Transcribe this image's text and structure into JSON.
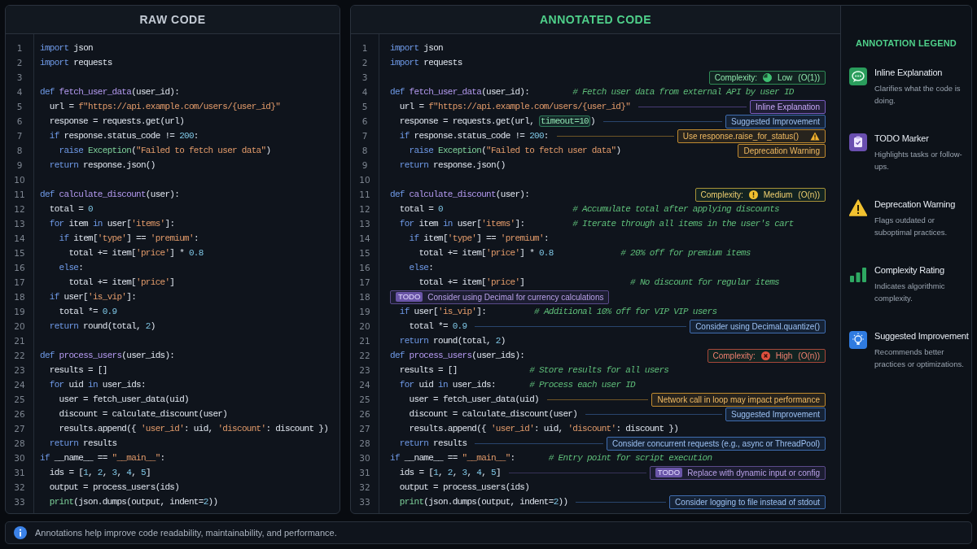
{
  "raw_panel": {
    "title": "RAW CODE",
    "lines": [
      {
        "number": "1",
        "tokens": [
          {
            "kind": "keyword",
            "text": "import"
          },
          {
            "kind": "plain",
            "text": " json"
          }
        ]
      },
      {
        "number": "2",
        "tokens": [
          {
            "kind": "keyword",
            "text": "import"
          },
          {
            "kind": "plain",
            "text": " requests"
          }
        ]
      },
      {
        "number": "3"
      },
      {
        "number": "4",
        "tokens": [
          {
            "kind": "keyword",
            "text": "def"
          },
          {
            "kind": "function",
            "text": " fetch_user_data"
          },
          {
            "kind": "plain",
            "text": "(user_id):"
          }
        ]
      },
      {
        "number": "5",
        "tokens": [
          {
            "kind": "plain",
            "text": "  url = "
          },
          {
            "kind": "string",
            "text": "f\"https://api.example.com/users/{user_id}\""
          }
        ]
      },
      {
        "number": "6",
        "tokens": [
          {
            "kind": "plain",
            "text": "  response = requests.get(url)"
          }
        ]
      },
      {
        "number": "7",
        "tokens": [
          {
            "kind": "keyword",
            "text": "  if"
          },
          {
            "kind": "plain",
            "text": " response.status_code != "
          },
          {
            "kind": "number",
            "text": "200"
          },
          {
            "kind": "plain",
            "text": ":"
          }
        ]
      },
      {
        "number": "8",
        "tokens": [
          {
            "kind": "keyword",
            "text": "    raise"
          },
          {
            "kind": "class",
            "text": " Exception"
          },
          {
            "kind": "plain",
            "text": "("
          },
          {
            "kind": "string",
            "text": "\"Failed to fetch user data\""
          },
          {
            "kind": "plain",
            "text": ")"
          }
        ]
      },
      {
        "number": "9",
        "tokens": [
          {
            "kind": "keyword",
            "text": "  return"
          },
          {
            "kind": "plain",
            "text": " response.json()"
          }
        ]
      },
      {
        "number": "10"
      },
      {
        "number": "11",
        "tokens": [
          {
            "kind": "keyword",
            "text": "def"
          },
          {
            "kind": "function",
            "text": " calculate_discount"
          },
          {
            "kind": "plain",
            "text": "(user):"
          }
        ]
      },
      {
        "number": "12",
        "tokens": [
          {
            "kind": "plain",
            "text": "  total = "
          },
          {
            "kind": "number",
            "text": "0"
          }
        ]
      },
      {
        "number": "13",
        "tokens": [
          {
            "kind": "keyword",
            "text": "  for"
          },
          {
            "kind": "plain",
            "text": " item "
          },
          {
            "kind": "keyword",
            "text": "in"
          },
          {
            "kind": "plain",
            "text": " user["
          },
          {
            "kind": "string",
            "text": "'items'"
          },
          {
            "kind": "plain",
            "text": "]:"
          }
        ]
      },
      {
        "number": "14",
        "tokens": [
          {
            "kind": "keyword",
            "text": "    if"
          },
          {
            "kind": "plain",
            "text": " item["
          },
          {
            "kind": "string",
            "text": "'type'"
          },
          {
            "kind": "plain",
            "text": "] == "
          },
          {
            "kind": "string",
            "text": "'premium'"
          },
          {
            "kind": "plain",
            "text": ":"
          }
        ]
      },
      {
        "number": "15",
        "tokens": [
          {
            "kind": "plain",
            "text": "      total += item["
          },
          {
            "kind": "string",
            "text": "'price'"
          },
          {
            "kind": "plain",
            "text": "] * "
          },
          {
            "kind": "number",
            "text": "0.8"
          }
        ]
      },
      {
        "number": "16",
        "tokens": [
          {
            "kind": "keyword",
            "text": "    else"
          },
          {
            "kind": "plain",
            "text": ":"
          }
        ]
      },
      {
        "number": "17",
        "tokens": [
          {
            "kind": "plain",
            "text": "      total += item["
          },
          {
            "kind": "string",
            "text": "'price'"
          },
          {
            "kind": "plain",
            "text": "]"
          }
        ]
      },
      {
        "number": "18",
        "tokens": [
          {
            "kind": "keyword",
            "text": "  if"
          },
          {
            "kind": "plain",
            "text": " user["
          },
          {
            "kind": "string",
            "text": "'is_vip'"
          },
          {
            "kind": "plain",
            "text": "]:"
          }
        ]
      },
      {
        "number": "19",
        "tokens": [
          {
            "kind": "plain",
            "text": "    total *= "
          },
          {
            "kind": "number",
            "text": "0.9"
          }
        ]
      },
      {
        "number": "20",
        "tokens": [
          {
            "kind": "keyword",
            "text": "  return"
          },
          {
            "kind": "plain",
            "text": " round(total, "
          },
          {
            "kind": "number",
            "text": "2"
          },
          {
            "kind": "plain",
            "text": ")"
          }
        ]
      },
      {
        "number": "21"
      },
      {
        "number": "22",
        "tokens": [
          {
            "kind": "keyword",
            "text": "def"
          },
          {
            "kind": "function",
            "text": " process_users"
          },
          {
            "kind": "plain",
            "text": "(user_ids):"
          }
        ]
      },
      {
        "number": "23",
        "tokens": [
          {
            "kind": "plain",
            "text": "  results = []"
          }
        ]
      },
      {
        "number": "24",
        "tokens": [
          {
            "kind": "keyword",
            "text": "  for"
          },
          {
            "kind": "plain",
            "text": " uid "
          },
          {
            "kind": "keyword",
            "text": "in"
          },
          {
            "kind": "plain",
            "text": " user_ids:"
          }
        ]
      },
      {
        "number": "25",
        "tokens": [
          {
            "kind": "plain",
            "text": "    user = fetch_user_data(uid)"
          }
        ]
      },
      {
        "number": "26",
        "tokens": [
          {
            "kind": "plain",
            "text": "    discount = calculate_discount(user)"
          }
        ]
      },
      {
        "number": "27",
        "tokens": [
          {
            "kind": "plain",
            "text": "    results.append({ "
          },
          {
            "kind": "string",
            "text": "'user_id'"
          },
          {
            "kind": "plain",
            "text": ": uid, "
          },
          {
            "kind": "string",
            "text": "'discount'"
          },
          {
            "kind": "plain",
            "text": ": discount })"
          }
        ]
      },
      {
        "number": "28",
        "tokens": [
          {
            "kind": "keyword",
            "text": "  return"
          },
          {
            "kind": "plain",
            "text": " results"
          }
        ]
      },
      {
        "number": "30",
        "tokens": [
          {
            "kind": "keyword",
            "text": "if"
          },
          {
            "kind": "plain",
            "text": " __name__ == "
          },
          {
            "kind": "string",
            "text": "\"__main__\""
          },
          {
            "kind": "plain",
            "text": ":"
          }
        ]
      },
      {
        "number": "31",
        "tokens": [
          {
            "kind": "plain",
            "text": "  ids = ["
          },
          {
            "kind": "number",
            "text": "1"
          },
          {
            "kind": "plain",
            "text": ", "
          },
          {
            "kind": "number",
            "text": "2"
          },
          {
            "kind": "plain",
            "text": ", "
          },
          {
            "kind": "number",
            "text": "3"
          },
          {
            "kind": "plain",
            "text": ", "
          },
          {
            "kind": "number",
            "text": "4"
          },
          {
            "kind": "plain",
            "text": ", "
          },
          {
            "kind": "number",
            "text": "5"
          },
          {
            "kind": "plain",
            "text": "]"
          }
        ]
      },
      {
        "number": "32",
        "tokens": [
          {
            "kind": "plain",
            "text": "  output = process_users(ids)"
          }
        ]
      },
      {
        "number": "33",
        "tokens": [
          {
            "kind": "class",
            "text": "  print"
          },
          {
            "kind": "plain",
            "text": "(json.dumps(output, indent="
          },
          {
            "kind": "number",
            "text": "2"
          },
          {
            "kind": "plain",
            "text": "))"
          }
        ]
      }
    ]
  },
  "annotated_panel": {
    "title": "ANNOTATED CODE",
    "lines": [
      {
        "number": "1",
        "tokens": [
          {
            "kind": "keyword",
            "text": "import"
          },
          {
            "kind": "plain",
            "text": " json"
          }
        ]
      },
      {
        "number": "2",
        "tokens": [
          {
            "kind": "keyword",
            "text": "import"
          },
          {
            "kind": "plain",
            "text": " requests"
          }
        ]
      },
      {
        "number": "3",
        "annotation": {
          "kind": "complexity",
          "label": "Complexity:",
          "color": "#3fbf72",
          "rating_text": "Low",
          "notation": "(O(1))",
          "leader": false
        }
      },
      {
        "number": "4",
        "tokens": [
          {
            "kind": "keyword",
            "text": "def"
          },
          {
            "kind": "function",
            "text": " fetch_user_data"
          },
          {
            "kind": "plain",
            "text": "(user_id):"
          },
          {
            "kind": "comment",
            "text": "         # Fetch user data from external API by user ID"
          }
        ]
      },
      {
        "number": "5",
        "tokens": [
          {
            "kind": "plain",
            "text": "  url = "
          },
          {
            "kind": "string",
            "text": "f\"https://api.example.com/users/{user_id}\""
          }
        ],
        "annotation": {
          "kind": "explanation",
          "text": "Inline Explanation",
          "leader": true
        }
      },
      {
        "number": "6",
        "tokens": [
          {
            "kind": "plain",
            "text": "  response = requests.get(url, "
          },
          {
            "kind": "highlight",
            "text": "timeout=10"
          },
          {
            "kind": "plain",
            "text": ")"
          }
        ],
        "annotation": {
          "kind": "suggestion",
          "text": "Suggested Improvement",
          "leader": true
        }
      },
      {
        "number": "7",
        "tokens": [
          {
            "kind": "keyword",
            "text": "  if"
          },
          {
            "kind": "plain",
            "text": " response.status_code != "
          },
          {
            "kind": "number",
            "text": "200"
          },
          {
            "kind": "plain",
            "text": ":"
          }
        ],
        "annotation": {
          "kind": "deprecation",
          "text": "Use response.raise_for_status()",
          "leader": true
        }
      },
      {
        "number": "8",
        "tokens": [
          {
            "kind": "keyword",
            "text": "    raise"
          },
          {
            "kind": "class",
            "text": " Exception"
          },
          {
            "kind": "plain",
            "text": "("
          },
          {
            "kind": "string",
            "text": "\"Failed to fetch user data\""
          },
          {
            "kind": "plain",
            "text": ")"
          }
        ],
        "annotation": {
          "kind": "warning",
          "text": "Deprecation Warning",
          "leader": false
        }
      },
      {
        "number": "9",
        "tokens": [
          {
            "kind": "keyword",
            "text": "  return"
          },
          {
            "kind": "plain",
            "text": " response.json()"
          }
        ]
      },
      {
        "number": "10"
      },
      {
        "number": "11",
        "tokens": [
          {
            "kind": "keyword",
            "text": "def"
          },
          {
            "kind": "function",
            "text": " calculate_discount"
          },
          {
            "kind": "plain",
            "text": "(user):"
          }
        ],
        "annotation": {
          "kind": "complexity",
          "label": "Complexity:",
          "color": "#f0c030",
          "rating_text": "Medium",
          "notation": "(O(n))",
          "leader": false
        }
      },
      {
        "number": "12",
        "tokens": [
          {
            "kind": "plain",
            "text": "  total = "
          },
          {
            "kind": "number",
            "text": "0"
          },
          {
            "kind": "comment",
            "text": "                           # Accumulate total after applying discounts"
          }
        ]
      },
      {
        "number": "13",
        "tokens": [
          {
            "kind": "keyword",
            "text": "  for"
          },
          {
            "kind": "plain",
            "text": " item "
          },
          {
            "kind": "keyword",
            "text": "in"
          },
          {
            "kind": "plain",
            "text": " user["
          },
          {
            "kind": "string",
            "text": "'items'"
          },
          {
            "kind": "plain",
            "text": "]:"
          },
          {
            "kind": "comment",
            "text": "          # Iterate through all items in the user's cart"
          }
        ]
      },
      {
        "number": "14",
        "tokens": [
          {
            "kind": "keyword",
            "text": "    if"
          },
          {
            "kind": "plain",
            "text": " item["
          },
          {
            "kind": "string",
            "text": "'type'"
          },
          {
            "kind": "plain",
            "text": "] == "
          },
          {
            "kind": "string",
            "text": "'premium'"
          },
          {
            "kind": "plain",
            "text": ":"
          }
        ]
      },
      {
        "number": "15",
        "tokens": [
          {
            "kind": "plain",
            "text": "      total += item["
          },
          {
            "kind": "string",
            "text": "'price'"
          },
          {
            "kind": "plain",
            "text": "] * "
          },
          {
            "kind": "number",
            "text": "0.8"
          },
          {
            "kind": "comment",
            "text": "              # 20% off for premium items"
          }
        ]
      },
      {
        "number": "16",
        "tokens": [
          {
            "kind": "keyword",
            "text": "    else"
          },
          {
            "kind": "plain",
            "text": ":"
          }
        ]
      },
      {
        "number": "17",
        "tokens": [
          {
            "kind": "plain",
            "text": "      total += item["
          },
          {
            "kind": "string",
            "text": "'price'"
          },
          {
            "kind": "plain",
            "text": "]"
          },
          {
            "kind": "comment",
            "text": "                      # No discount for regular items"
          }
        ]
      },
      {
        "number": "18",
        "annotation": {
          "kind": "todo",
          "tag": "TODO",
          "text": "Consider using Decimal for currency calculations",
          "leader": false
        }
      },
      {
        "number": "19",
        "tokens": [
          {
            "kind": "keyword",
            "text": "  if"
          },
          {
            "kind": "plain",
            "text": " user["
          },
          {
            "kind": "string",
            "text": "'is_vip'"
          },
          {
            "kind": "plain",
            "text": "]:"
          },
          {
            "kind": "comment",
            "text": "          # Additional 10% off for VIP VIP users"
          }
        ]
      },
      {
        "number": "20",
        "tokens": [
          {
            "kind": "plain",
            "text": "    total *= "
          },
          {
            "kind": "number",
            "text": "0.9"
          }
        ],
        "annotation": {
          "kind": "suggestion",
          "text": "Consider using Decimal.quantize()",
          "leader": true
        }
      },
      {
        "number": "21",
        "tokens": [
          {
            "kind": "keyword",
            "text": "  return"
          },
          {
            "kind": "plain",
            "text": " round(total, "
          },
          {
            "kind": "number",
            "text": "2"
          },
          {
            "kind": "plain",
            "text": ")"
          }
        ]
      },
      {
        "number": "22",
        "tokens": [
          {
            "kind": "keyword",
            "text": "def"
          },
          {
            "kind": "function",
            "text": " process_users"
          },
          {
            "kind": "plain",
            "text": "(user_ids):"
          }
        ],
        "annotation": {
          "kind": "complexity",
          "label": "Complexity:",
          "color": "#e0503e",
          "rating_text": "High",
          "notation": "(O(n))",
          "leader": false
        }
      },
      {
        "number": "23",
        "tokens": [
          {
            "kind": "plain",
            "text": "  results = []"
          },
          {
            "kind": "comment",
            "text": "               # Store results for all users"
          }
        ]
      },
      {
        "number": "24",
        "tokens": [
          {
            "kind": "keyword",
            "text": "  for"
          },
          {
            "kind": "plain",
            "text": " uid "
          },
          {
            "kind": "keyword",
            "text": "in"
          },
          {
            "kind": "plain",
            "text": " user_ids:"
          },
          {
            "kind": "comment",
            "text": "       # Process each user ID"
          }
        ]
      },
      {
        "number": "25",
        "tokens": [
          {
            "kind": "plain",
            "text": "    user = fetch_user_data(uid)"
          }
        ],
        "annotation": {
          "kind": "warning",
          "text": "Network call in loop may impact performance",
          "leader": true
        }
      },
      {
        "number": "26",
        "tokens": [
          {
            "kind": "plain",
            "text": "    discount = calculate_discount(user)"
          }
        ],
        "annotation": {
          "kind": "suggestion",
          "text": "Suggested Improvement",
          "leader": true
        }
      },
      {
        "number": "27",
        "tokens": [
          {
            "kind": "plain",
            "text": "    results.append({ "
          },
          {
            "kind": "string",
            "text": "'user_id'"
          },
          {
            "kind": "plain",
            "text": ": uid, "
          },
          {
            "kind": "string",
            "text": "'discount'"
          },
          {
            "kind": "plain",
            "text": ": discount })"
          }
        ]
      },
      {
        "number": "28",
        "tokens": [
          {
            "kind": "keyword",
            "text": "  return"
          },
          {
            "kind": "plain",
            "text": " results"
          }
        ],
        "annotation": {
          "kind": "suggestion",
          "text": "Consider concurrent requests (e.g., async or ThreadPool)",
          "leader": true
        }
      },
      {
        "number": "30",
        "tokens": [
          {
            "kind": "keyword",
            "text": "if"
          },
          {
            "kind": "plain",
            "text": " __name__ == "
          },
          {
            "kind": "string",
            "text": "\"__main__\""
          },
          {
            "kind": "plain",
            "text": ":"
          },
          {
            "kind": "comment",
            "text": "       # Entry point for script execution"
          }
        ]
      },
      {
        "number": "31",
        "tokens": [
          {
            "kind": "plain",
            "text": "  ids = ["
          },
          {
            "kind": "number",
            "text": "1"
          },
          {
            "kind": "plain",
            "text": ", "
          },
          {
            "kind": "number",
            "text": "2"
          },
          {
            "kind": "plain",
            "text": ", "
          },
          {
            "kind": "number",
            "text": "3"
          },
          {
            "kind": "plain",
            "text": ", "
          },
          {
            "kind": "number",
            "text": "4"
          },
          {
            "kind": "plain",
            "text": ", "
          },
          {
            "kind": "number",
            "text": "5"
          },
          {
            "kind": "plain",
            "text": "]"
          }
        ],
        "annotation": {
          "kind": "todo",
          "tag": "TODO",
          "text": "Replace with dynamic input or config",
          "leader": true
        }
      },
      {
        "number": "32",
        "tokens": [
          {
            "kind": "plain",
            "text": "  output = process_users(ids)"
          }
        ]
      },
      {
        "number": "33",
        "tokens": [
          {
            "kind": "class",
            "text": "  print"
          },
          {
            "kind": "plain",
            "text": "(json.dumps(output, indent="
          },
          {
            "kind": "number",
            "text": "2"
          },
          {
            "kind": "plain",
            "text": "))"
          }
        ],
        "annotation": {
          "kind": "suggestion",
          "text": "Consider logging to file instead of stdout",
          "leader": true
        }
      }
    ]
  },
  "legend": {
    "title": "ANNOTATION LEGEND",
    "items": [
      {
        "kind": "explanation",
        "title": "Inline Explanation",
        "description": "Clarifies what the code is doing."
      },
      {
        "kind": "todo",
        "title": "TODO Marker",
        "description": "Highlights tasks or follow-ups."
      },
      {
        "kind": "warning",
        "title": "Deprecation Warning",
        "description": "Flags outdated or suboptimal practices."
      },
      {
        "kind": "complexity",
        "title": "Complexity Rating",
        "description": "Indicates algorithmic complexity."
      },
      {
        "kind": "suggestion",
        "title": "Suggested Improvement",
        "description": "Recommends better practices or optimizations."
      }
    ]
  },
  "footer": {
    "text": "Annotations help improve code readability, maintainability, and performance."
  }
}
